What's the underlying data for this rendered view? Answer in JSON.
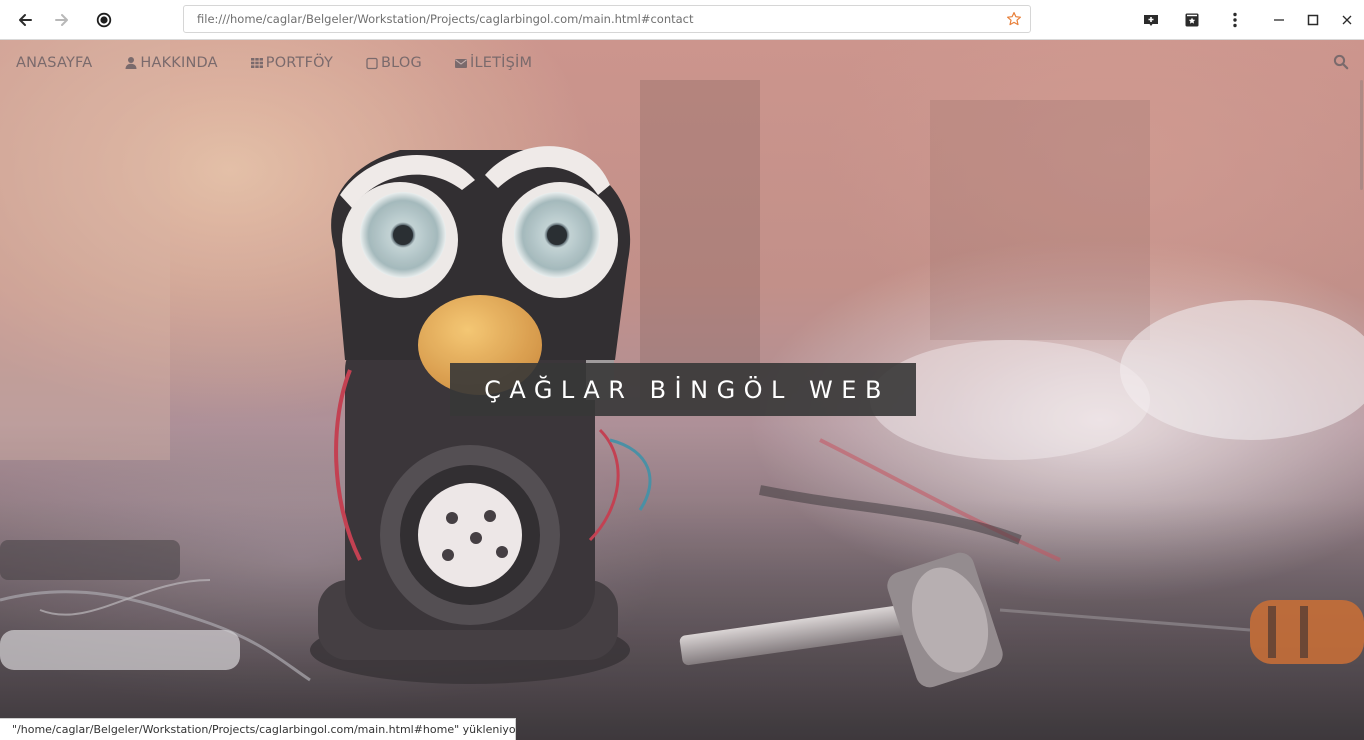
{
  "browser": {
    "url": "file:///home/caglar/Belgeler/Workstation/Projects/caglarbingol.com/main.html#contact",
    "status_text": "\"/home/caglar/Belgeler/Workstation/Projects/caglarbingol.com/main.html#home\" yükleniyor...",
    "icons": [
      "back-arrow-icon",
      "forward-arrow-icon",
      "record-icon",
      "star-icon",
      "add-bookmark-icon",
      "bookmarks-icon",
      "menu-dots-icon",
      "minimize-icon",
      "maximize-icon",
      "close-icon"
    ]
  },
  "site": {
    "nav": [
      {
        "label": "ANASAYFA",
        "icon": ""
      },
      {
        "label": "HAKKINDA",
        "icon": "user-icon"
      },
      {
        "label": "PORTFÖY",
        "icon": "grid-icon"
      },
      {
        "label": "BLOG",
        "icon": "square-icon"
      },
      {
        "label": "İLETİŞİM",
        "icon": "envelope-icon"
      }
    ],
    "hero_title": "ÇAĞLAR BİNGÖL WEB"
  },
  "colors": {
    "nav_text": "#7a6a6c",
    "hero_box": "#373737",
    "star_accent": "#e8803a"
  }
}
